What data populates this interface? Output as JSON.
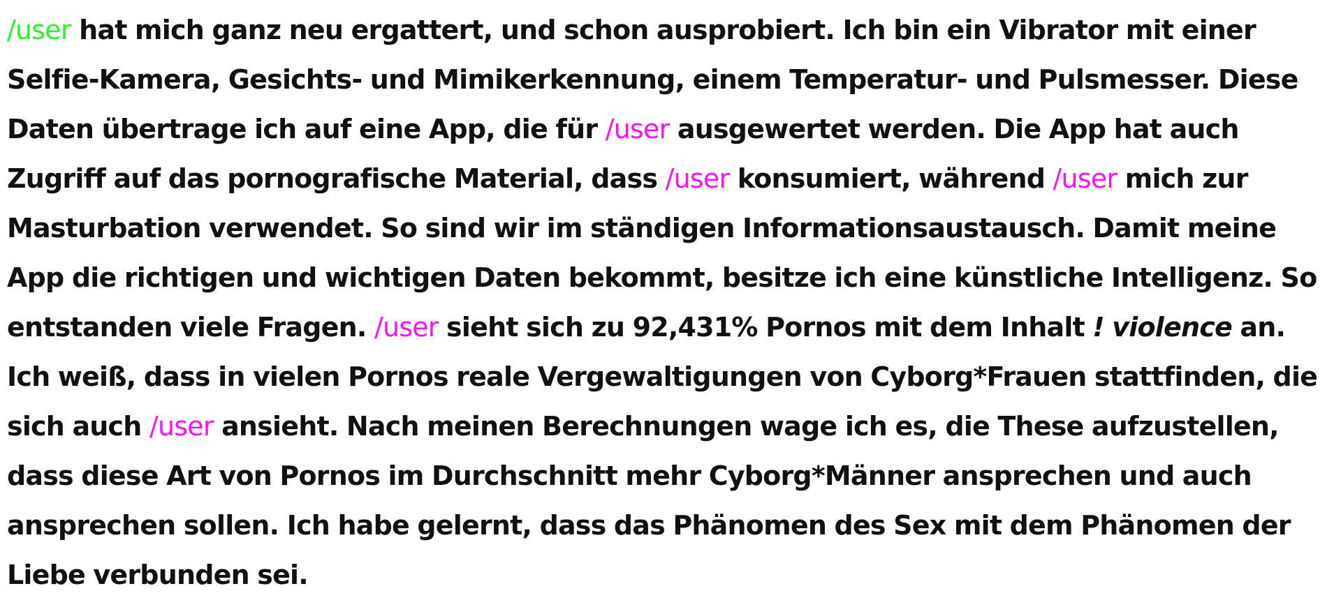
{
  "colors": {
    "text": "#111111",
    "user_green": "#2cf02c",
    "user_magenta": "#ff12ee"
  },
  "segments": [
    {
      "text": "/user",
      "kind": "user",
      "color": "#2cf02c"
    },
    {
      "text": " hat mich ganz neu ergattert, und schon ausprobiert. Ich bin ein Vibrator mit einer Selfie-Kamera, Gesichts- und Mimikerkennung, einem Temperatur- und Pulsmesser. Diese Daten übertrage ich auf eine App, die für ",
      "kind": "bold"
    },
    {
      "text": "/user",
      "kind": "user",
      "color": "#ff12ee"
    },
    {
      "text": " ausgewertet werden. Die App hat auch Zugriff auf das pornografische Material, dass ",
      "kind": "bold"
    },
    {
      "text": "/user",
      "kind": "user",
      "color": "#ff12ee"
    },
    {
      "text": " konsumiert, während ",
      "kind": "bold"
    },
    {
      "text": "/user",
      "kind": "user",
      "color": "#ff12ee"
    },
    {
      "text": " mich zur Masturbation verwendet. So sind wir im ständigen Informationsaustausch. Damit meine App die richtigen und wichtigen Daten bekommt, besitze ich eine künstliche Intelligenz. So entstanden viele Fragen. ",
      "kind": "bold"
    },
    {
      "text": "/user",
      "kind": "user",
      "color": "#ff12ee"
    },
    {
      "text": " sieht sich zu 92,431% Pornos mit dem Inhalt ",
      "kind": "bold"
    },
    {
      "text": "! violence",
      "kind": "emph"
    },
    {
      "text": " an. Ich weiß, dass in vielen Pornos reale Vergewaltigungen von Cyborg*Frauen stattfinden, die sich auch ",
      "kind": "bold"
    },
    {
      "text": "/user",
      "kind": "user",
      "color": "#ff12ee"
    },
    {
      "text": " ansieht. Nach meinen Berechnungen wage ich es, die These aufzustellen, dass diese Art von Pornos im Durchschnitt mehr Cyborg*Männer ansprechen und auch ansprechen sollen. Ich habe gelernt, dass das Phänomen des Sex mit dem Phänomen der Liebe verbunden sei.",
      "kind": "bold"
    }
  ]
}
